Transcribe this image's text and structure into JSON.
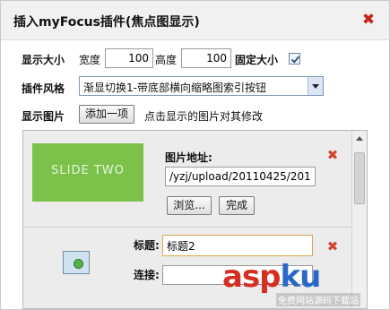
{
  "window": {
    "title": "插入myFocus插件(焦点图显示)",
    "close_icon": "close-icon"
  },
  "size": {
    "label": "显示大小",
    "width_label": "宽度",
    "width_value": "100",
    "height_label": "高度",
    "height_value": "100",
    "fixed_label": "固定大小",
    "fixed_checked": true
  },
  "style": {
    "label": "插件风格",
    "selected": "渐显切换1-带底部横向缩略图索引按钮"
  },
  "images": {
    "label": "显示图片",
    "add_button": "添加一项",
    "hint": "点击显示的图片对其修改",
    "items": [
      {
        "thumb_text": "SLIDE TWO",
        "address_label": "图片地址:",
        "address_value": "/yzj/upload/20110425/201",
        "browse_button": "浏览...",
        "done_button": "完成"
      },
      {
        "title_label": "标题:",
        "title_value": "标题2",
        "link_label": "连接:"
      }
    ]
  },
  "watermark": {
    "brand": "aspku",
    "tagline": "免费网站源码下载站"
  },
  "colors": {
    "accent_red": "#c8211a",
    "thumb_green": "#7cc24a"
  }
}
